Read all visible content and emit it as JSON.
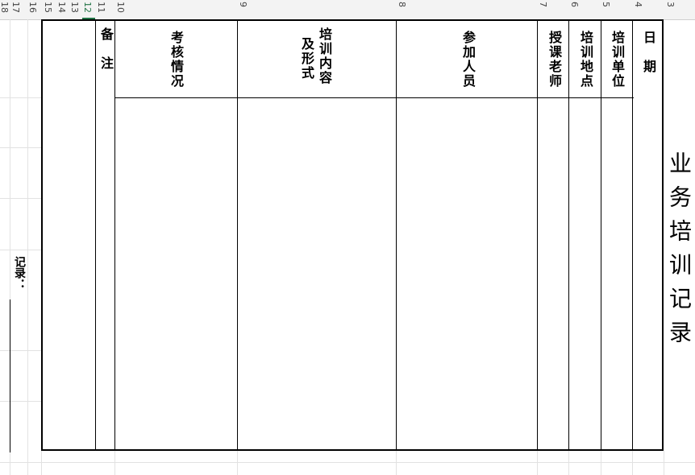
{
  "row_numbers": [
    "18",
    "17",
    "16",
    "15",
    "14",
    "13",
    "12",
    "11",
    "10",
    "9",
    "8",
    "7",
    "6",
    "5",
    "4",
    "3"
  ],
  "selected_row": "12",
  "form": {
    "title": "业务培训记录",
    "date_label": "日　期",
    "unit_label": "培训单位",
    "location_label": "培训地点",
    "teacher_label": "授课老师",
    "participants_label": "参加人员",
    "content_label_line1": "培训内容",
    "content_label_line2": "及形式",
    "assessment_label": "考核情况",
    "remarks_label": "备　注",
    "record_label": "记录："
  },
  "colors": {
    "selected_accent": "#217346",
    "gridline": "#e2e2e2",
    "header_bg": "#f3f3f3"
  }
}
